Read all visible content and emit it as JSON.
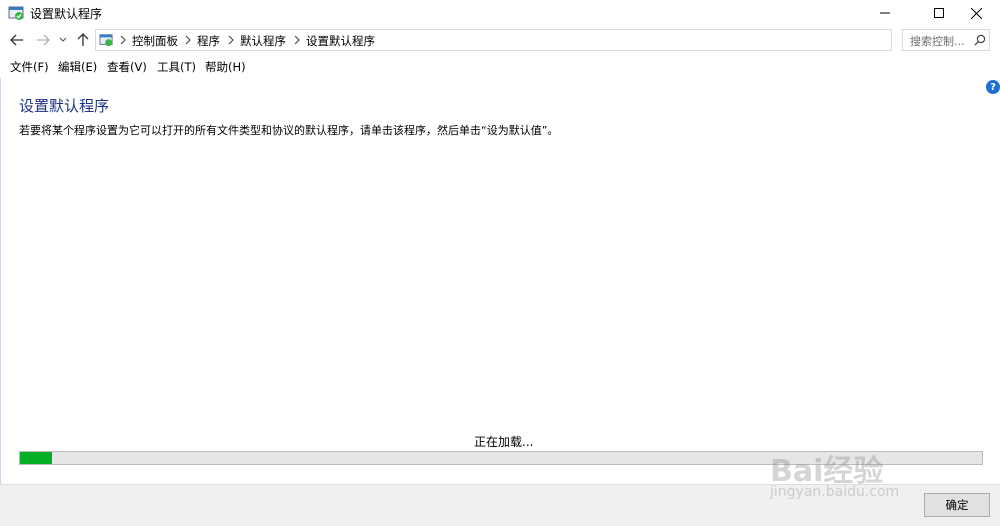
{
  "window": {
    "title": "设置默认程序"
  },
  "address_bar": {
    "breadcrumbs": [
      "控制面板",
      "程序",
      "默认程序",
      "设置默认程序"
    ]
  },
  "search": {
    "placeholder": "搜索控制..."
  },
  "menu": {
    "items": [
      "文件(F)",
      "编辑(E)",
      "查看(V)",
      "工具(T)",
      "帮助(H)"
    ]
  },
  "main": {
    "title": "设置默认程序",
    "description": "若要将某个程序设置为它可以打开的所有文件类型和协议的默认程序，请单击该程序，然后单击“设为默认值”。",
    "loading_text": "正在加载...",
    "progress": 0.033
  },
  "footer": {
    "ok_label": "确定"
  },
  "watermark": {
    "logo": "Bai经验",
    "url": "jingyan.baidu.com"
  },
  "colors": {
    "title_blue": "#1e3287",
    "progress_green": "#06b025",
    "help_blue": "#1e6fd0"
  }
}
